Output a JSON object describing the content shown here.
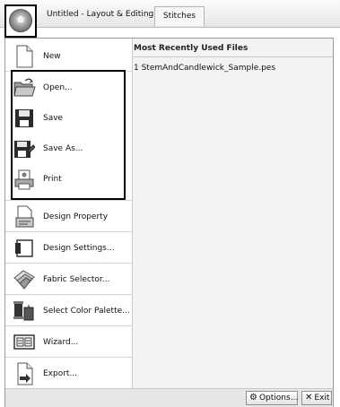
{
  "titlebar": {
    "app_button_glyph": "✿",
    "document_title": "Untitled - Layout & Editing",
    "tab_stitches": "Stitches"
  },
  "menu": {
    "items": [
      {
        "label": "New",
        "icon": "new-document-icon"
      },
      {
        "label": "Open...",
        "icon": "open-folder-icon"
      },
      {
        "label": "Save",
        "icon": "save-disk-icon"
      },
      {
        "label": "Save As...",
        "icon": "save-as-icon"
      },
      {
        "label": "Print",
        "icon": "printer-icon"
      },
      {
        "label": "Design Property",
        "icon": "design-property-icon"
      },
      {
        "label": "Design Settings...",
        "icon": "design-settings-icon"
      },
      {
        "label": "Fabric Selector...",
        "icon": "fabric-selector-icon"
      },
      {
        "label": "Select Color Palette...",
        "icon": "color-palette-icon"
      },
      {
        "label": "Wizard...",
        "icon": "wizard-icon"
      },
      {
        "label": "Export...",
        "icon": "export-icon"
      }
    ]
  },
  "mru": {
    "header": "Most Recently Used Files",
    "files": [
      "1 StemAndCandlewick_Sample.pes"
    ]
  },
  "bottom": {
    "options_label": "Options...",
    "exit_label": "Exit"
  }
}
